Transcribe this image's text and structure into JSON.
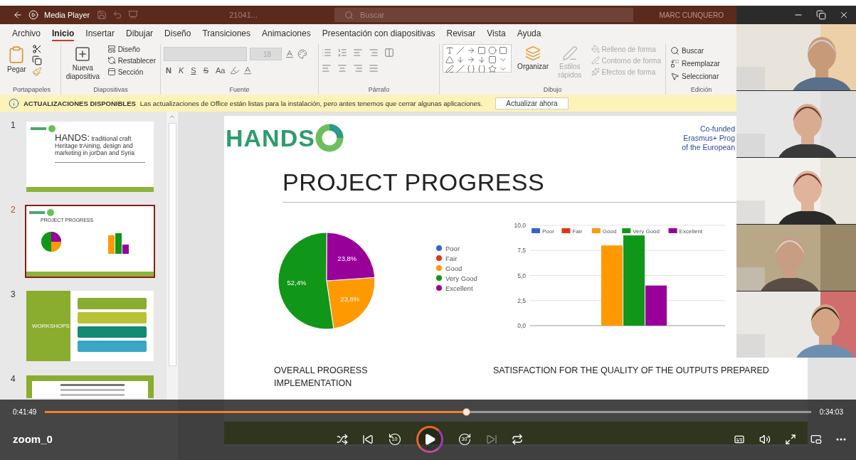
{
  "title_bar": {
    "app_label": "Media Player",
    "document": "21041...",
    "search": {
      "placeholder": "Buscar"
    },
    "user": "MARC CUNQUERO"
  },
  "ribbon_tabs": [
    {
      "label": "Archivo",
      "selected": false
    },
    {
      "label": "Inicio",
      "selected": true
    },
    {
      "label": "Insertar",
      "selected": false
    },
    {
      "label": "Dibujar",
      "selected": false
    },
    {
      "label": "Diseño",
      "selected": false
    },
    {
      "label": "Transiciones",
      "selected": false
    },
    {
      "label": "Animaciones",
      "selected": false
    },
    {
      "label": "Presentación con diapositivas",
      "selected": false
    },
    {
      "label": "Revisar",
      "selected": false
    },
    {
      "label": "Vista",
      "selected": false
    },
    {
      "label": "Ayuda",
      "selected": false
    }
  ],
  "ribbon": {
    "clipboard": {
      "paste": "Pegar",
      "group": "Portapapeles"
    },
    "slides": {
      "new_slide": "Nueva diapositiva",
      "items": [
        "Diseño",
        "Restablecer",
        "Sección"
      ],
      "group": "Diapositivas"
    },
    "font": {
      "size": "18",
      "buttons": [
        "N",
        "K",
        "S",
        "S",
        "Aa"
      ],
      "group": "Fuente"
    },
    "paragraph": {
      "group": "Párrafo"
    },
    "drawing": {
      "arrange": "Organizar",
      "quick_styles": {
        "label": "Estilos rápidos",
        "disabled": true
      },
      "items": [
        {
          "label": "Relleno de forma",
          "disabled": true
        },
        {
          "label": "Contorno de forma",
          "disabled": true
        },
        {
          "label": "Efectos de forma",
          "disabled": true
        }
      ],
      "group": "Dibujo"
    },
    "editing": {
      "items": [
        {
          "label": "Buscar",
          "kind": "search"
        },
        {
          "label": "Reemplazar",
          "kind": "replace"
        },
        {
          "label": "Seleccionar",
          "kind": "select"
        }
      ],
      "group": "Edición"
    }
  },
  "info_bar": {
    "title": "ACTUALIZACIONES DISPONIBLES",
    "message": "Las actualizaciones de Office están listas para la instalación, pero antes tenemos que cerrar algunas aplicaciones.",
    "button": "Actualizar ahora"
  },
  "thumbnails": [
    {
      "number": "1",
      "selected": false,
      "kind": "title",
      "heading": "HANDS:",
      "title": "traditional craft Heritage trAining, design and marketing in jorDan and Syria"
    },
    {
      "number": "2",
      "selected": true,
      "kind": "charts",
      "title": "PROJECT PROGRESS"
    },
    {
      "number": "3",
      "selected": false,
      "kind": "workshops",
      "title": "WORKSHOPS"
    },
    {
      "number": "4",
      "selected": false,
      "kind": "table"
    }
  ],
  "slide": {
    "logo": "HANDS",
    "funding": [
      "Co-funded",
      "Erasmus+ Prog",
      "of the European"
    ],
    "title": "PROJECT PROGRESS",
    "pie": {
      "chart_data": {
        "type": "pie",
        "categories": [
          "Poor",
          "Fair",
          "Good",
          "Very Good",
          "Excellent"
        ],
        "colors": [
          "#3366cc",
          "#dc3912",
          "#ff9900",
          "#109618",
          "#990099"
        ],
        "values": [
          0,
          0,
          23.8,
          52.4,
          23.8
        ],
        "value_labels": [
          null,
          null,
          "23,8%",
          "52,4%",
          "23,8%"
        ],
        "legend": "right"
      }
    },
    "bars": {
      "chart_data": {
        "type": "bar",
        "grid": true,
        "legend": "top",
        "ylim": [
          0,
          10
        ],
        "yticks": [
          {
            "value": 0,
            "label": "0,0"
          },
          {
            "value": 2.5,
            "label": "2,5"
          },
          {
            "value": 5,
            "label": "5,0"
          },
          {
            "value": 7.5,
            "label": "7,5"
          },
          {
            "value": 10,
            "label": "10,0"
          }
        ],
        "series": [
          {
            "name": "Poor",
            "color": "#3366cc",
            "values": [
              0
            ]
          },
          {
            "name": "Fair",
            "color": "#dc3912",
            "values": [
              0
            ]
          },
          {
            "name": "Good",
            "color": "#ff9900",
            "values": [
              8
            ]
          },
          {
            "name": "Very Good",
            "color": "#109618",
            "values": [
              9
            ]
          },
          {
            "name": "Excellent",
            "color": "#990099",
            "values": [
              4
            ]
          }
        ]
      }
    },
    "captions": [
      "OVERALL PROGRESS IMPLEMENTATION",
      "SATISFACTION FOR THE QUALITY OF THE OUTPUTS PREPARED"
    ]
  },
  "player": {
    "elapsed": "0:41:49",
    "remaining": "0:34:03",
    "level": 0.551,
    "title": "zoom_0",
    "skip_back": "10",
    "skip_forward": "30",
    "playing": false
  }
}
